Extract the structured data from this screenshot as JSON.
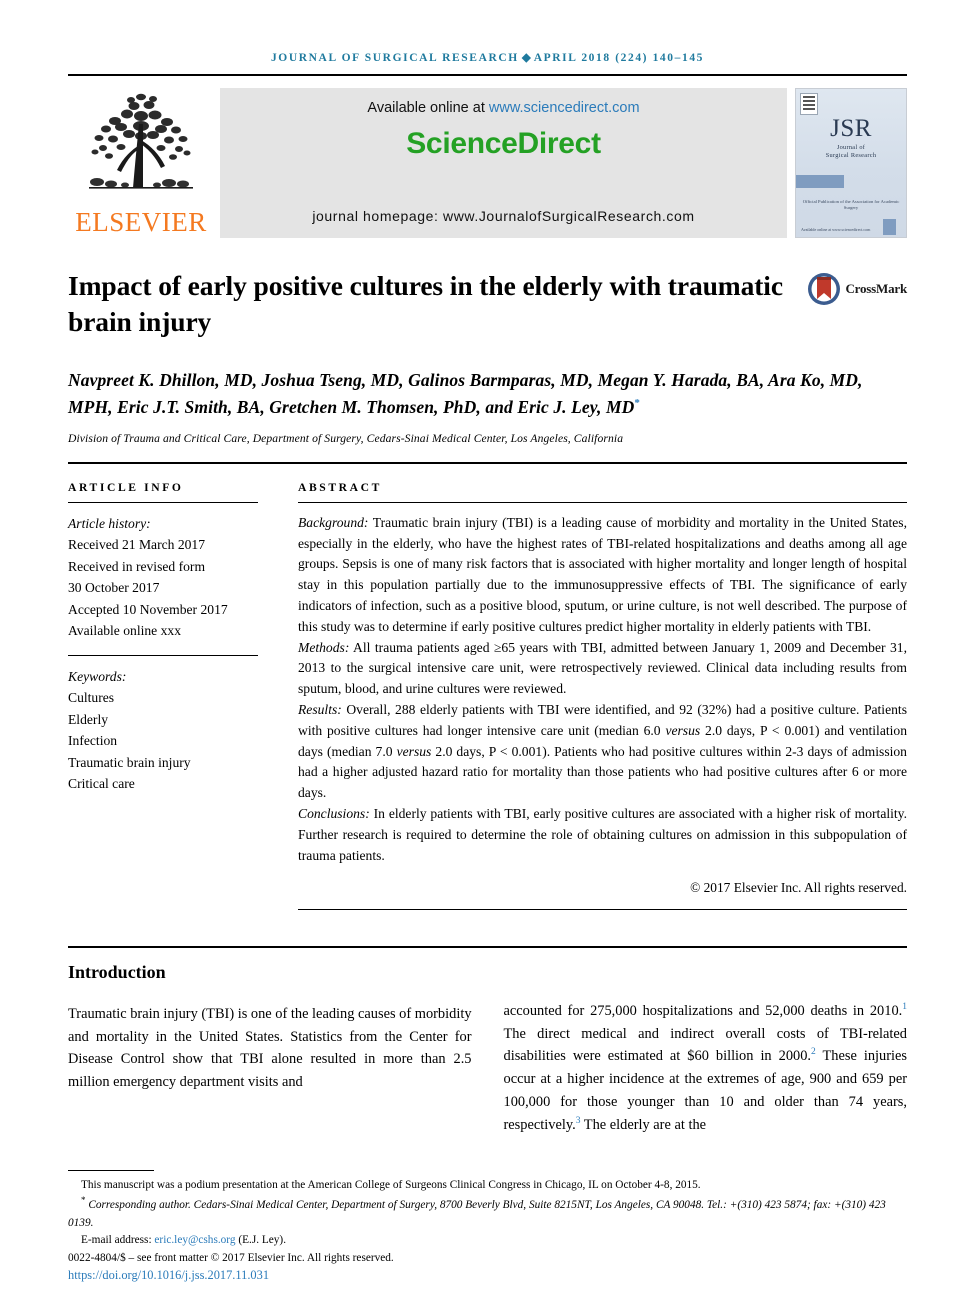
{
  "running_head": {
    "prefix": "JOURNAL OF SURGICAL RESEARCH",
    "diamond": "◆",
    "suffix": "APRIL 2018 (224) 140–145"
  },
  "banner": {
    "publisher": "ELSEVIER",
    "available_text": "Available online at",
    "available_url": "www.sciencedirect.com",
    "brand": "ScienceDirect",
    "homepage": "journal homepage: www.JournalofSurgicalResearch.com"
  },
  "cover": {
    "acronym": "JSR",
    "sub_line1": "Journal of",
    "sub_line2": "Surgical Research",
    "note": "Official Publication of the Association for Academic Surgery",
    "footer": "Available online at www.sciencedirect.com"
  },
  "article": {
    "title": "Impact of early positive cultures in the elderly with traumatic brain injury",
    "crossmark_label": "CrossMark",
    "authors": "Navpreet K. Dhillon, MD, Joshua Tseng, MD, Galinos Barmparas, MD, Megan Y. Harada, BA, Ara Ko, MD, MPH, Eric J.T. Smith, BA, Gretchen M. Thomsen, PhD, and Eric J. Ley, MD",
    "corresponding_marker": "*",
    "affiliation": "Division of Trauma and Critical Care, Department of Surgery, Cedars-Sinai Medical Center, Los Angeles, California"
  },
  "info": {
    "heading": "ARTICLE INFO",
    "history_label": "Article history:",
    "history": [
      "Received 21 March 2017",
      "Received in revised form",
      "30 October 2017",
      "Accepted 10 November 2017",
      "Available online xxx"
    ],
    "keywords_label": "Keywords:",
    "keywords": [
      "Cultures",
      "Elderly",
      "Infection",
      "Traumatic brain injury",
      "Critical care"
    ]
  },
  "abstract": {
    "heading": "ABSTRACT",
    "background_label": "Background:",
    "background": " Traumatic brain injury (TBI) is a leading cause of morbidity and mortality in the United States, especially in the elderly, who have the highest rates of TBI-related hospitalizations and deaths among all age groups. Sepsis is one of many risk factors that is associated with higher mortality and longer length of hospital stay in this population partially due to the immunosuppressive effects of TBI. The significance of early indicators of infection, such as a positive blood, sputum, or urine culture, is not well described. The purpose of this study was to determine if early positive cultures predict higher mortality in elderly patients with TBI.",
    "methods_label": "Methods:",
    "methods": " All trauma patients aged ≥65 years with TBI, admitted between January 1, 2009 and December 31, 2013 to the surgical intensive care unit, were retrospectively reviewed. Clinical data including results from sputum, blood, and urine cultures were reviewed.",
    "results_label": "Results:",
    "results_part1": " Overall, 288 elderly patients with TBI were identified, and 92 (32%) had a positive culture. Patients with positive cultures had longer intensive care unit (median 6.0 ",
    "results_versus1": "versus",
    "results_part2": " 2.0 days, P < 0.001) and ventilation days (median 7.0 ",
    "results_versus2": "versus",
    "results_part3": " 2.0 days, P < 0.001). Patients who had positive cultures within 2-3 days of admission had a higher adjusted hazard ratio for mortality than those patients who had positive cultures after 6 or more days.",
    "conclusions_label": "Conclusions:",
    "conclusions": " In elderly patients with TBI, early positive cultures are associated with a higher risk of mortality. Further research is required to determine the role of obtaining cultures on admission in this subpopulation of trauma patients.",
    "copyright": "© 2017 Elsevier Inc. All rights reserved."
  },
  "introduction": {
    "heading": "Introduction",
    "left_paragraph": "Traumatic brain injury (TBI) is one of the leading causes of morbidity and mortality in the United States. Statistics from the Center for Disease Control show that TBI alone resulted in more than 2.5 million emergency department visits and",
    "right_part1": "accounted for 275,000 hospitalizations and 52,000 deaths in 2010.",
    "right_ref1": "1",
    "right_part2": " The direct medical and indirect overall costs of TBI-related disabilities were estimated at $60 billion in 2000.",
    "right_ref2": "2",
    "right_part3": " These injuries occur at a higher incidence at the extremes of age, 900 and 659 per 100,000 for those younger than 10 and older than 74 years, respectively.",
    "right_ref3": "3",
    "right_part4": " The elderly are at the"
  },
  "footnotes": {
    "presentation": "This manuscript was a podium presentation at the American College of Surgeons Clinical Congress in Chicago, IL on October 4-8, 2015.",
    "corresponding_marker": "*",
    "corresponding": " Corresponding author. Cedars-Sinai Medical Center, Department of Surgery, 8700 Beverly Blvd, Suite 8215NT, Los Angeles, CA 90048. Tel.: +(310) 423 5874; fax: +(310) 423 0139.",
    "email_label": "E-mail address:",
    "email": "eric.ley@cshs.org",
    "email_suffix": " (E.J. Ley).",
    "issn_line": "0022-4804/$ – see front matter © 2017 Elsevier Inc. All rights reserved.",
    "doi": "https://doi.org/10.1016/j.jss.2017.11.031"
  },
  "colors": {
    "journal_head": "#1f7a9e",
    "link": "#2b7bba",
    "elsevier_orange": "#f47920",
    "sciencedirect_green": "#24a124",
    "crossmark_blue": "#3b5c8f",
    "crossmark_red": "#c0392b"
  }
}
